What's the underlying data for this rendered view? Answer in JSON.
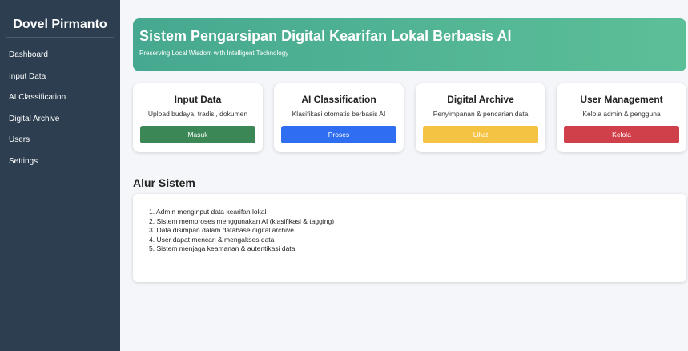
{
  "sidebar": {
    "brand": "Dovel Pirmanto",
    "items": [
      {
        "label": "Dashboard"
      },
      {
        "label": "Input Data"
      },
      {
        "label": "AI Classification"
      },
      {
        "label": "Digital Archive"
      },
      {
        "label": "Users"
      },
      {
        "label": "Settings"
      }
    ]
  },
  "hero": {
    "title": "Sistem Pengarsipan Digital Kearifan Lokal Berbasis AI",
    "subtitle": "Preserving Local Wisdom with Intelligent Technology"
  },
  "cards": [
    {
      "title": "Input Data",
      "description": "Upload budaya, tradisi, dokumen",
      "button_label": "Masuk",
      "button_color": "#3b8755"
    },
    {
      "title": "AI Classification",
      "description": "Klasifikasi otomatis berbasis AI",
      "button_label": "Proses",
      "button_color": "#2f6ef0"
    },
    {
      "title": "Digital Archive",
      "description": "Penyimpanan & pencarian data",
      "button_label": "Lihat",
      "button_color": "#f5c343"
    },
    {
      "title": "User Management",
      "description": "Kelola admin & pengguna",
      "button_label": "Kelola",
      "button_color": "#d0404a"
    }
  ],
  "flow": {
    "title": "Alur Sistem",
    "steps": [
      "1. Admin menginput data kearifan lokal",
      "2. Sistem memproses menggunakan AI (klasifikasi & tagging)",
      "3. Data disimpan dalam database digital archive",
      "4. User dapat mencari & mengakses data",
      "5. Sistem menjaga keamanan & autentikasi data"
    ]
  },
  "colors": {
    "sidebar_bg": "#2c3e50",
    "hero_gradient_start": "#46a890",
    "hero_gradient_end": "#5cbf98",
    "page_bg": "#f4f6f9"
  }
}
